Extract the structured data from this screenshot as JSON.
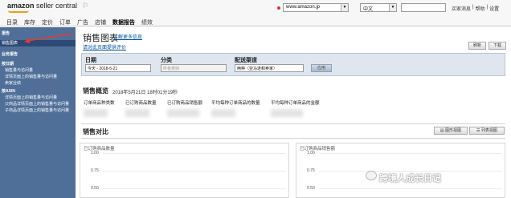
{
  "header": {
    "logo_text": "amazon",
    "logo_sub": "seller central",
    "nav": [
      "目录",
      "库存",
      "定价",
      "订单",
      "广告",
      "店铺",
      "数据报告",
      "绩效"
    ],
    "marketplace": "www.amazon.jp",
    "language": "中文",
    "links": [
      "买家消息",
      "帮助",
      "设置"
    ]
  },
  "sidebar": {
    "top_label": "报告",
    "selected_label": "销售图表",
    "section1": "业务报告",
    "items1": [
      "按日期",
      "销售量与访问量",
      "详情页面上的销售量与访问量",
      "卖家业绩"
    ],
    "section2": "按ASIN",
    "items2": [
      "详情页面上的销售量与访问量",
      "父商品详情页面上的销售量与访问量",
      "子商品详情页面上的销售量与访问量"
    ]
  },
  "main": {
    "title": "销售图表",
    "learn_more": "了解更多信息",
    "rate_link": "请对此页面提供评价",
    "refresh": "刷新",
    "download": "下载",
    "filters": {
      "date_label": "日期",
      "date_value": "今天 - 2018-5-21",
      "category_label": "分类",
      "category_value": "所有类别",
      "channel_label": "配送渠道",
      "channel_value": "两种（亚马逊和卖家）",
      "apply": "应用"
    },
    "overview": {
      "title": "销售概览",
      "timestamp": "2018年5月21日 18时01分19秒",
      "metrics": [
        "订单商品种类数",
        "已订购商品数量",
        "已订购商品销售额",
        "平均每种订单商品的数量",
        "平均每种订单商品的金额"
      ]
    },
    "compare": {
      "title": "销售对比",
      "graph_view": "图形视图",
      "table_view": "列表视图",
      "left_chart_title": "已订购商品数量",
      "right_chart_title": "已订购商品销售额",
      "ticks": [
        "1.00",
        "0.75",
        "0.50"
      ]
    }
  },
  "watermark": "跨境人成长日记"
}
